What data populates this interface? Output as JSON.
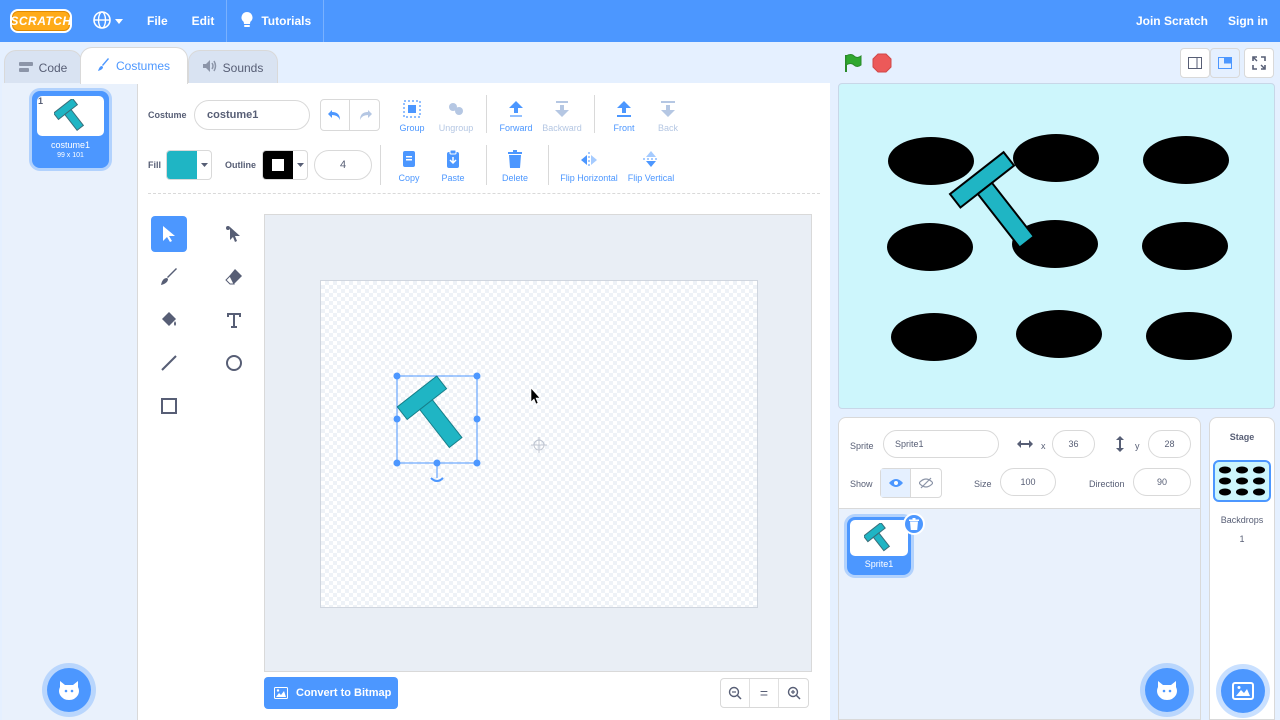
{
  "menubar": {
    "logo": "SCRATCH",
    "file": "File",
    "edit": "Edit",
    "tutorials": "Tutorials",
    "join": "Join Scratch",
    "signin": "Sign in"
  },
  "tabs": [
    {
      "label": "Code"
    },
    {
      "label": "Costumes"
    },
    {
      "label": "Sounds"
    }
  ],
  "costumes": [
    {
      "index": "1",
      "name": "costume1",
      "size": "99 x 101"
    }
  ],
  "editor": {
    "costume_label": "Costume",
    "costume_name": "costume1",
    "fill_label": "Fill",
    "fill_color": "#1fb5c4",
    "outline_label": "Outline",
    "outline_color": "#000000",
    "outline_width": "4",
    "group": "Group",
    "ungroup": "Ungroup",
    "forward": "Forward",
    "backward": "Backward",
    "front": "Front",
    "back": "Back",
    "copy": "Copy",
    "paste": "Paste",
    "delete": "Delete",
    "flip_horizontal": "Flip Horizontal",
    "flip_vertical": "Flip Vertical",
    "convert_bitmap": "Convert to Bitmap",
    "zoom_reset": "="
  },
  "sprite_info": {
    "sprite_label": "Sprite",
    "sprite_name": "Sprite1",
    "x_label": "x",
    "x": "36",
    "y_label": "y",
    "y": "28",
    "show_label": "Show",
    "size_label": "Size",
    "size": "100",
    "direction_label": "Direction",
    "direction": "90"
  },
  "sprites": [
    {
      "name": "Sprite1"
    }
  ],
  "stage_panel": {
    "title": "Stage",
    "backdrops_label": "Backdrops",
    "backdrops_count": "1"
  },
  "colors": {
    "accent": "#4c97ff",
    "hammer": "#1fb5c4",
    "stage_bg": "#cdf6fc",
    "green_flag": "#2fa82f",
    "stop": "#ec5959"
  }
}
